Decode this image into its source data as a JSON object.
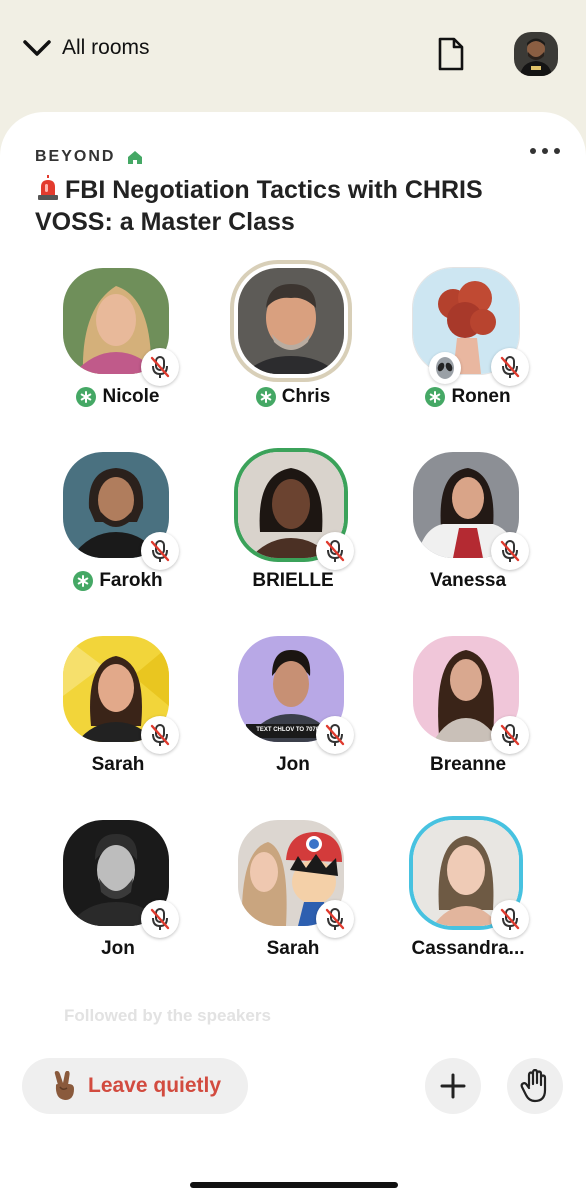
{
  "header": {
    "back_label": "All rooms",
    "back_icon": "chevron-down-icon",
    "document_icon": "document-icon",
    "profile_avatar": "profile-avatar"
  },
  "room": {
    "club_name": "BEYOND",
    "club_icon": "house-icon",
    "title": "FBI Negotiation Tactics with CHRIS VOSS: a Master Class",
    "title_emoji": "siren-icon",
    "menu_icon": "more-dots-icon"
  },
  "speakers": [
    {
      "name": "Nicole",
      "moderator": true,
      "muted": true
    },
    {
      "name": "Chris",
      "moderator": true,
      "muted": false,
      "speaking": true
    },
    {
      "name": "Ronen",
      "moderator": true,
      "muted": true,
      "badge": "alien-icon"
    },
    {
      "name": "Farokh",
      "moderator": true,
      "muted": true
    },
    {
      "name": "BRIELLE",
      "moderator": false,
      "muted": true,
      "speaking": true
    },
    {
      "name": "Vanessa",
      "moderator": false,
      "muted": true
    },
    {
      "name": "Sarah",
      "moderator": false,
      "muted": true
    },
    {
      "name": "Jon",
      "moderator": false,
      "muted": true,
      "avatar_text": "TEXT CHLOV TO 707070"
    },
    {
      "name": "Breanne",
      "moderator": false,
      "muted": true
    },
    {
      "name": "Jon",
      "moderator": false,
      "muted": true
    },
    {
      "name": "Sarah",
      "moderator": false,
      "muted": true
    },
    {
      "name": "Cassandra...",
      "moderator": false,
      "muted": true
    }
  ],
  "section_label": "Followed by the speakers",
  "footer": {
    "leave_label": "Leave quietly",
    "leave_emoji": "peace-hand-icon",
    "add_icon": "plus-icon",
    "raise_hand_icon": "raise-hand-icon"
  },
  "colors": {
    "background": "#f1efe4",
    "moderator_green": "#45a865",
    "leave_red": "#d24b3f",
    "speaking_ring": "#3ba25a"
  }
}
